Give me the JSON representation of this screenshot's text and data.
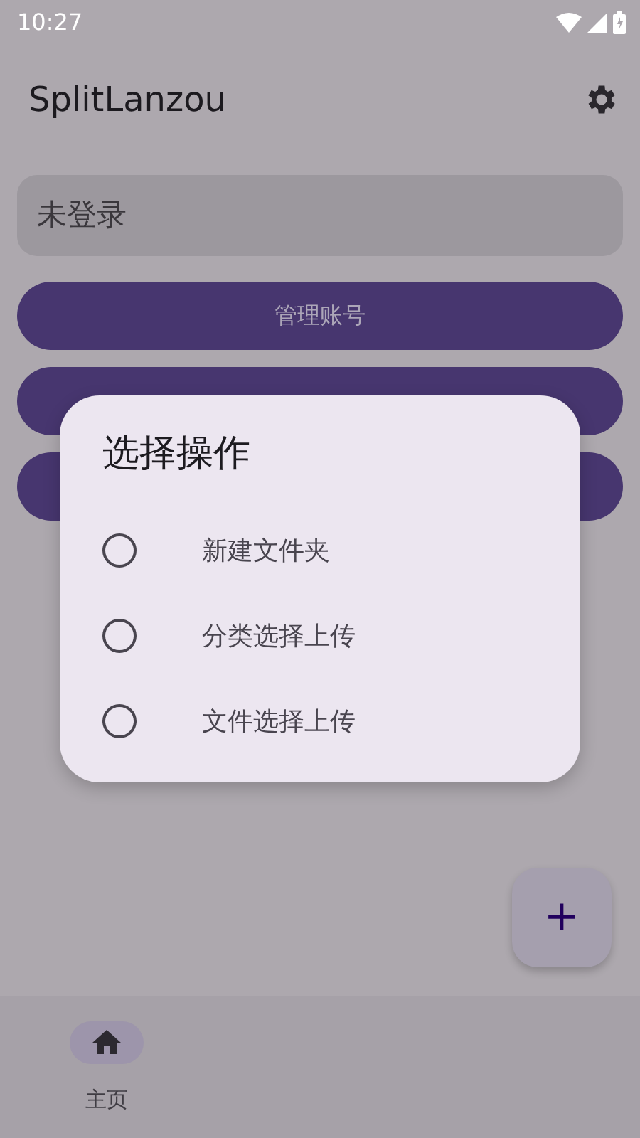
{
  "status_bar": {
    "time": "10:27"
  },
  "app_bar": {
    "title": "SplitLanzou"
  },
  "account_field": {
    "value": "未登录"
  },
  "buttons": [
    {
      "kind": "labeled",
      "label": "管理账号"
    },
    {
      "kind": "covered"
    },
    {
      "kind": "covered"
    }
  ],
  "dialog": {
    "title": "选择操作",
    "options": [
      {
        "label": "新建文件夹",
        "selected": false
      },
      {
        "label": "分类选择上传",
        "selected": false
      },
      {
        "label": "文件选择上传",
        "selected": false
      }
    ]
  },
  "fab": {
    "label": "+"
  },
  "bottom_nav": [
    {
      "label": "主页",
      "selected": true
    }
  ]
}
